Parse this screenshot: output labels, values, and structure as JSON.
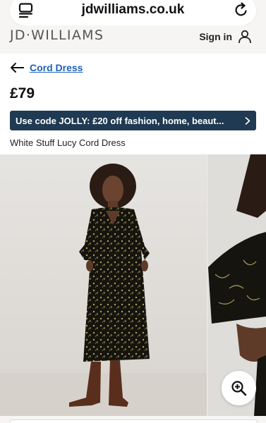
{
  "browser": {
    "url": "jdwilliams.co.uk",
    "tabs_icon": "tabs-icon",
    "reload_icon": "reload-icon"
  },
  "header": {
    "logo": "JD·WILLIAMS",
    "sign_in_label": "Sign in",
    "user_icon": "user-icon"
  },
  "product": {
    "back_icon": "arrow-left-icon",
    "breadcrumb": "Cord Dress",
    "price": "£79",
    "promo_text": "Use code JOLLY: £20 off fashion, home, beaut...",
    "promo_icon": "chevron-right-icon",
    "name": "White Stuff Lucy Cord Dress"
  },
  "gallery": {
    "zoom_icon": "zoom-in-icon"
  },
  "colors": {
    "promo_bg": "#1f3a52",
    "link": "#1f62b8"
  }
}
